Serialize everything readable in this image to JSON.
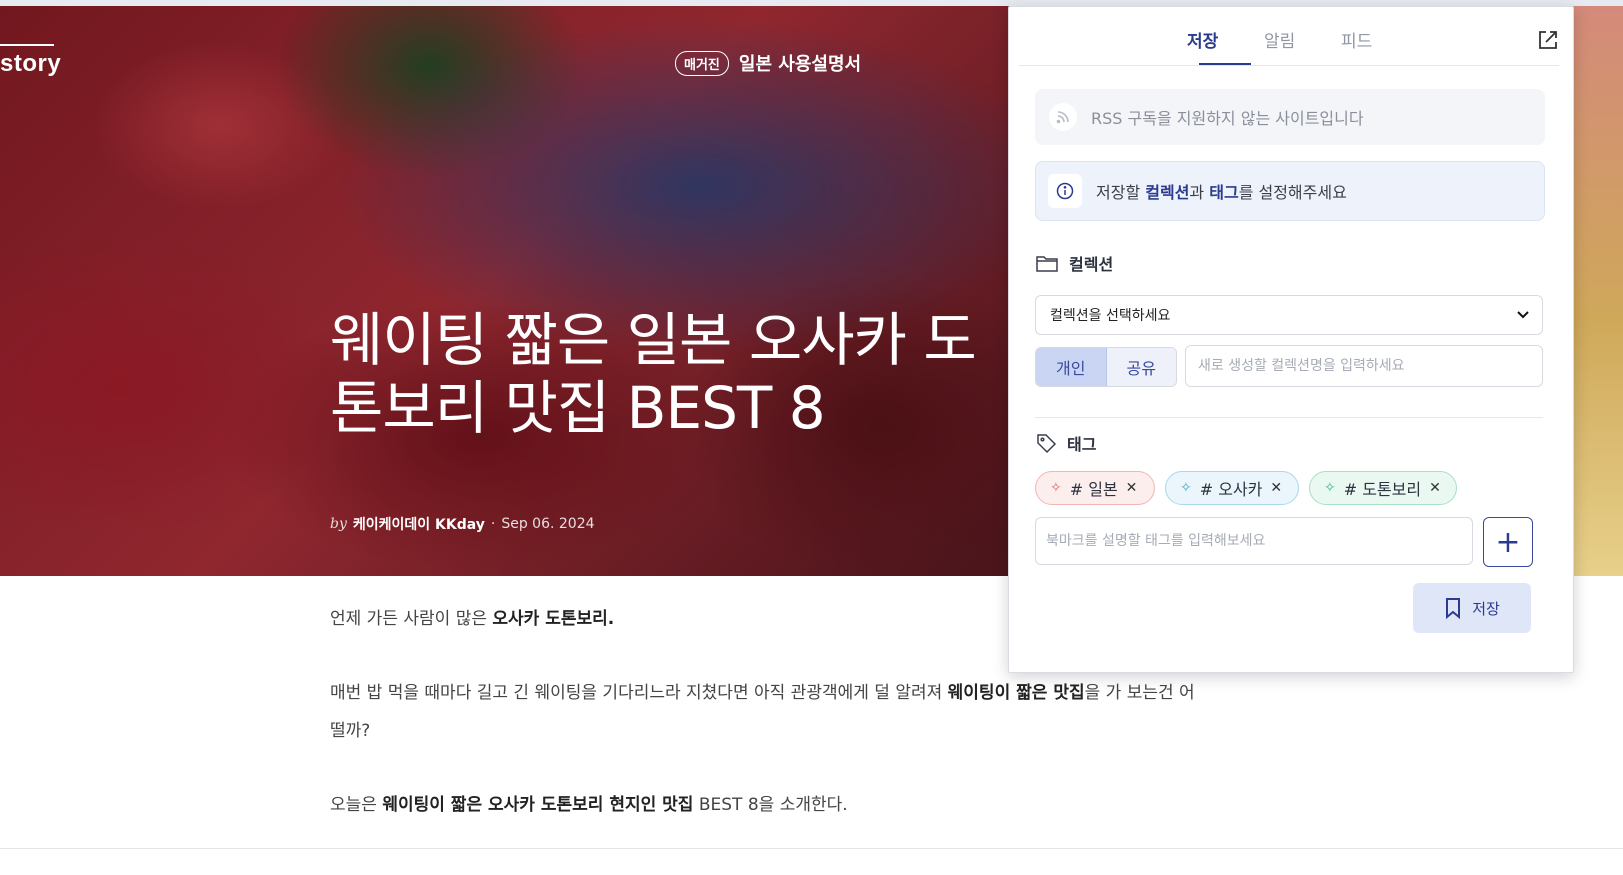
{
  "hero": {
    "brand": "story",
    "magazine_badge": "매거진",
    "magazine_category": "일본 사용설명서",
    "title": "웨이팅 짧은 일본 오사카 도톤보리 맛집 BEST 8",
    "by": "by",
    "author": "케이케이데이 KKday",
    "date": "Sep 06. 2024"
  },
  "article": {
    "p1_text": "언제 가든 사람이 많은 ",
    "p1_bold": "오사카 도톤보리.",
    "p2_text_a": "매번 밥 먹을 때마다 길고 긴 웨이팅을 기다리느라 지쳤다면 아직 관광객에게 덜 알려져 ",
    "p2_bold": "웨이팅이 짧은 맛집",
    "p2_text_b": "을 가 보는건 어떨까?",
    "p3_text_a": "오늘은 ",
    "p3_bold": "웨이팅이 짧은 오사카 도톤보리 현지인 맛집",
    "p3_text_b": " BEST 8을 소개한다."
  },
  "popup": {
    "tabs": [
      {
        "label": "저장",
        "active": true
      },
      {
        "label": "알림",
        "active": false
      },
      {
        "label": "피드",
        "active": false
      }
    ],
    "rss_notice": "RSS 구독을 지원하지 않는 사이트입니다",
    "info": {
      "pre": "저장할 ",
      "collection": "컬렉션",
      "mid": "과 ",
      "tag": "태그",
      "post": "를 설정해주세요"
    },
    "collection_label": "컬렉션",
    "collection_select": "컬렉션을 선택하세요",
    "scope_personal": "개인",
    "scope_shared": "공유",
    "new_collection_placeholder": "새로 생성할 컬렉션명을 입력하세요",
    "tag_label": "태그",
    "tags": [
      "# 일본",
      "# 오사카",
      "# 도톤보리"
    ],
    "tag_input_placeholder": "북마크를 설명할 태그를 입력해보세요",
    "save_label": "저장"
  },
  "colors": {
    "accent": "#2b3b8f",
    "chip_red": "#fdeeee",
    "chip_blue": "#eaf6fb",
    "chip_green": "#eaf8f2"
  }
}
